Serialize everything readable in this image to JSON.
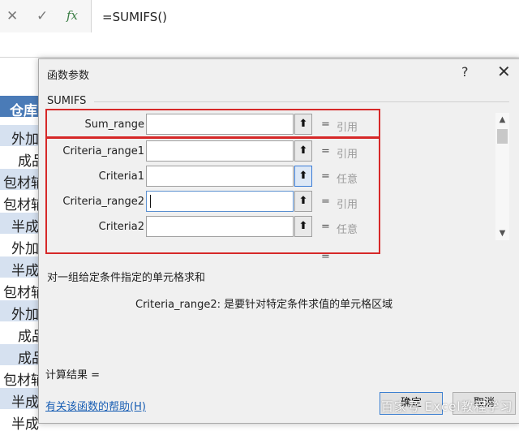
{
  "formula_bar": {
    "cancel_icon": "close-icon",
    "cancel_glyph": "✕",
    "enter_icon": "check-icon",
    "enter_glyph": "✓",
    "fx_label": "fx",
    "formula": "=SUMIFS()"
  },
  "sheet": {
    "header": "仓库",
    "cells": [
      "外加",
      "成品",
      "包材辅",
      "包材辅",
      "半成",
      "外加",
      "半成",
      "包材辅",
      "外加",
      "成品",
      "成品",
      "包材辅",
      "半成",
      "半成"
    ]
  },
  "dialog": {
    "title": "函数参数",
    "help_glyph": "?",
    "close_glyph": "✕",
    "function_name": "SUMIFS",
    "args": [
      {
        "label": "Sum_range",
        "type": "引用"
      },
      {
        "label": "Criteria_range1",
        "type": "引用"
      },
      {
        "label": "Criteria1",
        "type": "任意"
      },
      {
        "label": "Criteria_range2",
        "type": "引用"
      },
      {
        "label": "Criteria2",
        "type": "任意"
      }
    ],
    "collapse_glyph": "⬆",
    "equals": "=",
    "description": "对一组给定条件指定的单元格求和",
    "param_description": "Criteria_range2:  是要针对特定条件求值的单元格区域",
    "result_label": "计算结果 =",
    "help_link": "有关该函数的帮助(H)",
    "ok_label": "确定",
    "cancel_label": "取消"
  },
  "watermark": "百家号 Excel教程学习",
  "colors": {
    "highlight_box": "#d62828",
    "sheet_header": "#4a7bb7",
    "sheet_alt_row": "#d6e1f0",
    "link": "#1a5fb4"
  }
}
